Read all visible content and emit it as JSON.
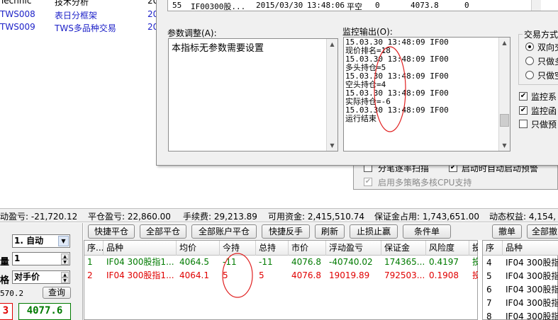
{
  "background_list": {
    "rows": [
      {
        "code": "Technic",
        "name": "技术分析",
        "num": "20"
      },
      {
        "code": "TWS008",
        "name": "表日分框架",
        "num": "20"
      },
      {
        "code": "TWS009",
        "name": "TWS多品种交易",
        "num": "20"
      }
    ]
  },
  "history_row": {
    "seq": "55",
    "contract": "IF00300股...",
    "date": "2015/03/30",
    "time": "13:48:06",
    "action": "平空",
    "qty": "0",
    "price": "4073.8",
    "extra": "0"
  },
  "params": {
    "label": "参数调整(A):",
    "text": "本指标无参数需要设置"
  },
  "monitor": {
    "label": "监控输出(O):",
    "lines": [
      "15.03.30 13:48:09 IF00",
      "现价排名=18",
      "15.03.30 13:48:09 IF00",
      "多头持仓=5",
      "15.03.30 13:48:09 IF00",
      "空头持仓=4",
      "15.03.30 13:48:09 IF00",
      "实际持仓=-6",
      "15.03.30 13:48:09 IF00",
      "运行结束"
    ]
  },
  "trade_mode": {
    "label": "交易方式",
    "options": [
      "双向交",
      "只做多",
      "只做空"
    ],
    "selected": 0
  },
  "checks": [
    {
      "label": "监控系",
      "checked": true
    },
    {
      "label": "监控函",
      "checked": true
    },
    {
      "label": "只做预",
      "checked": false
    }
  ],
  "dialog2": {
    "row1": "分笔逐率扫描",
    "row1b": "启动时自动启动预警",
    "row2": "启用多策略多核CPU支持"
  },
  "status": {
    "floating_pl": "动盈亏: -21,720.12",
    "close_pl": "平仓盈亏: 22,860.00",
    "fee": "手续费: 29,213.89",
    "available": "可用资金: 2,415,510.74",
    "margin": "保证金占用: 1,743,651.00",
    "equity": "动态权益: 4,154,"
  },
  "order_panel": {
    "mode": "1. 自动",
    "qty_label": "量",
    "qty": "1",
    "price_label": "格",
    "price_type": "对手价",
    "ref_price": "570.2",
    "query_label": "查询",
    "bid": "3",
    "ask": "4077.6"
  },
  "toolbar": {
    "buttons": [
      "快捷平仓",
      "全部平仓",
      "全部账户平仓",
      "快捷反手",
      "刷新",
      "止损止赢",
      "条件单"
    ],
    "cancel": "撤单",
    "cancel_all": "全部撤"
  },
  "positions": {
    "headers": [
      "序...",
      "品种",
      "均价",
      "今持",
      "总持",
      "市价",
      "浮动盈亏",
      "保证金",
      "风险度",
      "投"
    ],
    "rows": [
      {
        "seq": "1",
        "name": "IF04 300股指1...",
        "avg": "4064.5",
        "today": "-11",
        "total": "-11",
        "mkt": "4076.8",
        "pl": "-40740.02",
        "margin": "174365...",
        "risk": "0.4197",
        "flag": "投",
        "color": "green"
      },
      {
        "seq": "2",
        "name": "IF04 300股指1...",
        "avg": "4064.1",
        "today": "5",
        "total": "5",
        "mkt": "4076.8",
        "pl": "19019.89",
        "margin": "792503...",
        "risk": "0.1908",
        "flag": "投",
        "color": "red"
      }
    ]
  },
  "orders": {
    "headers": [
      "序",
      "品种"
    ],
    "rows": [
      {
        "seq": "4",
        "name": "IF04 300股指"
      },
      {
        "seq": "5",
        "name": "IF04 300股指"
      },
      {
        "seq": "6",
        "name": "IF04 300股指"
      },
      {
        "seq": "7",
        "name": "IF04 300股指"
      },
      {
        "seq": "8",
        "name": "IF04 300股指"
      }
    ]
  }
}
